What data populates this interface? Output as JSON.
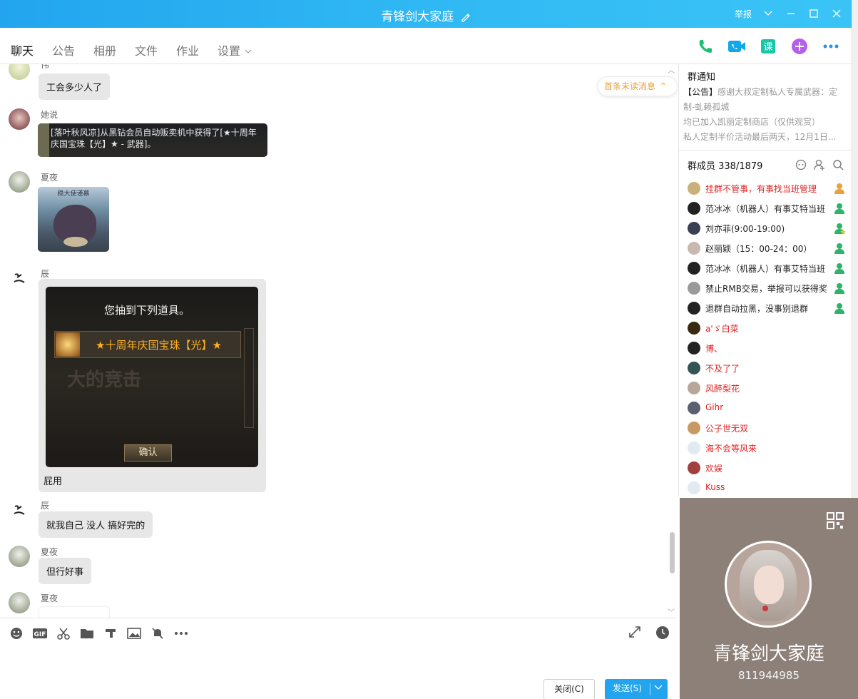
{
  "window": {
    "title": "青锋剑大家庭",
    "report": "举报"
  },
  "tabs": [
    "聊天",
    "公告",
    "相册",
    "文件",
    "作业",
    "设置"
  ],
  "messages": [
    {
      "sender": "伟",
      "text": "工会多少人了"
    },
    {
      "sender": "她说",
      "image_text": "[落叶秋风凉]从黑钻会员自动贩卖机中获得了[★十周年庆国宝珠【光】★ - 武器]。"
    },
    {
      "sender": "夏夜",
      "image_text": "稳大使谨慕"
    },
    {
      "sender": "辰",
      "image_title": "您抽到下列道具。",
      "image_item": "★十周年庆国宝珠【光】★",
      "image_button": "确认",
      "text": "屁用"
    },
    {
      "sender": "辰",
      "text": "就我自己  没人  搞好完的"
    },
    {
      "sender": "夏夜",
      "text": "但行好事"
    },
    {
      "sender": "夏夜",
      "text": ""
    }
  ],
  "unread_banner": "首条未读消息",
  "input": {
    "close_label": "关闭(C)",
    "send_label": "发送(S)"
  },
  "notice": {
    "title": "群通知",
    "lines": [
      "【公告】感谢大叔定制私人专属武器：定制-虬赖孤城",
      "均已加入凯丽定制商店（仅供观赏）",
      "私人定制半价活动最后两天，12月1日..."
    ],
    "prefix": "【公告】",
    "line1_rest": "感谢大叔定制私人专属武器：定制-虬赖孤城"
  },
  "members": {
    "title": "群成员 338/1879",
    "list": [
      {
        "name": "挂群不管事，有事找当班管理",
        "color": "#e02020",
        "role": "owner"
      },
      {
        "name": "范冰冰（机器人）有事艾特当班",
        "color": "#222",
        "role": "admin"
      },
      {
        "name": "刘亦菲(9:00-19:00)",
        "color": "#222",
        "role": "admin-star"
      },
      {
        "name": "赵丽颖（15：00-24：00）",
        "color": "#222",
        "role": "admin"
      },
      {
        "name": "范冰冰（机器人）有事艾特当班",
        "color": "#222",
        "role": "admin"
      },
      {
        "name": "禁止RMB交易，举报可以获得奖励",
        "color": "#222",
        "role": "admin"
      },
      {
        "name": "退群自动拉黑，没事别退群",
        "color": "#222",
        "role": "admin"
      },
      {
        "name": "a'ゞ白菜",
        "color": "#e02020",
        "role": ""
      },
      {
        "name": "博、",
        "color": "#e02020",
        "role": ""
      },
      {
        "name": "不及了了",
        "color": "#e02020",
        "role": ""
      },
      {
        "name": "风醉梨花",
        "color": "#e02020",
        "role": ""
      },
      {
        "name": "Gihr",
        "color": "#e02020",
        "role": ""
      },
      {
        "name": "公子世无双",
        "color": "#e02020",
        "role": ""
      },
      {
        "name": "海不会等风来",
        "color": "#e02020",
        "role": ""
      },
      {
        "name": "欢娱",
        "color": "#e02020",
        "role": ""
      },
      {
        "name": "Kuss",
        "color": "#e02020",
        "role": ""
      }
    ]
  },
  "group_card": {
    "name": "青锋剑大家庭",
    "id": "811944985"
  },
  "colors": {
    "titlebar": "#22a5ee",
    "bubble": "#e7e7e7",
    "red_name": "#e02020",
    "card_bg": "#8d8079"
  }
}
